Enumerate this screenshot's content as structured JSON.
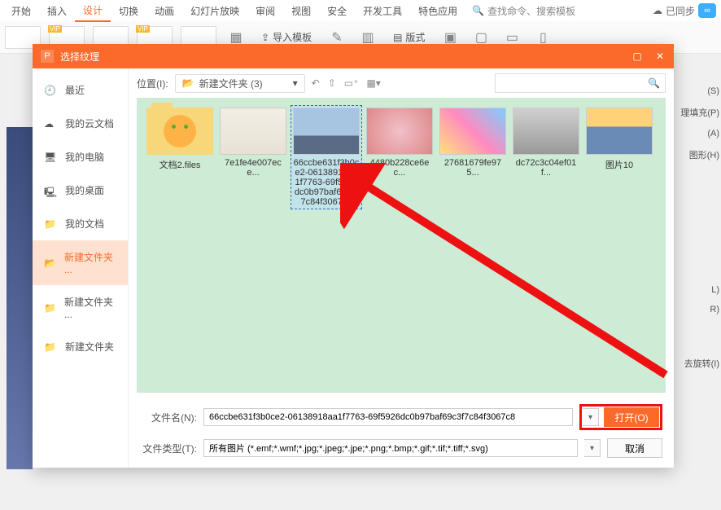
{
  "ribbon": {
    "tabs": [
      "开始",
      "插入",
      "设计",
      "切换",
      "动画",
      "幻灯片放映",
      "审阅",
      "视图",
      "安全",
      "开发工具",
      "特色应用"
    ],
    "active_tab": "设计",
    "search_placeholder": "查找命令、搜索模板",
    "sync_label": "已同步",
    "import_template": "导入模板",
    "page_format": "版式"
  },
  "dialog": {
    "title": "选择纹理",
    "location_label": "位置(I):",
    "location_value": "新建文件夹 (3)",
    "sidebar": [
      {
        "icon": "clock",
        "label": "最近"
      },
      {
        "icon": "cloud",
        "label": "我的云文档"
      },
      {
        "icon": "pc",
        "label": "我的电脑"
      },
      {
        "icon": "desktop",
        "label": "我的桌面"
      },
      {
        "icon": "folder",
        "label": "我的文档"
      },
      {
        "icon": "folder-active",
        "label": "新建文件夹 ..."
      },
      {
        "icon": "folder",
        "label": "新建文件夹 ..."
      },
      {
        "icon": "folder",
        "label": "新建文件夹"
      }
    ],
    "files": [
      {
        "name": "文档2.files",
        "kind": "folder"
      },
      {
        "name": "7e1fe4e007ece...",
        "kind": "img1"
      },
      {
        "name": "66ccbe631f3b0ce2-06138918aa1f7763-69f5926dc0b97baf69c3f7c84f3067c8",
        "kind": "img2",
        "selected": true
      },
      {
        "name": "4480b228ce6ec...",
        "kind": "img3"
      },
      {
        "name": "27681679fe975...",
        "kind": "img4"
      },
      {
        "name": "dc72c3c04ef01f...",
        "kind": "img5"
      },
      {
        "name": "图片10",
        "kind": "img6"
      }
    ],
    "filename_label": "文件名(N):",
    "filename_value": "66ccbe631f3b0ce2-06138918aa1f7763-69f5926dc0b97baf69c3f7c84f3067c8",
    "filetype_label": "文件类型(T):",
    "filetype_value": "所有图片 (*.emf;*.wmf;*.jpg;*.jpeg;*.jpe;*.png;*.bmp;*.gif;*.tif;*.tiff;*.svg)",
    "open_btn": "打开(O)",
    "cancel_btn": "取消"
  },
  "right_panel": [
    "(S)",
    "理填充(P)",
    "(A)",
    "图形(H)",
    "L)",
    "R)",
    "去旋转(I)"
  ]
}
